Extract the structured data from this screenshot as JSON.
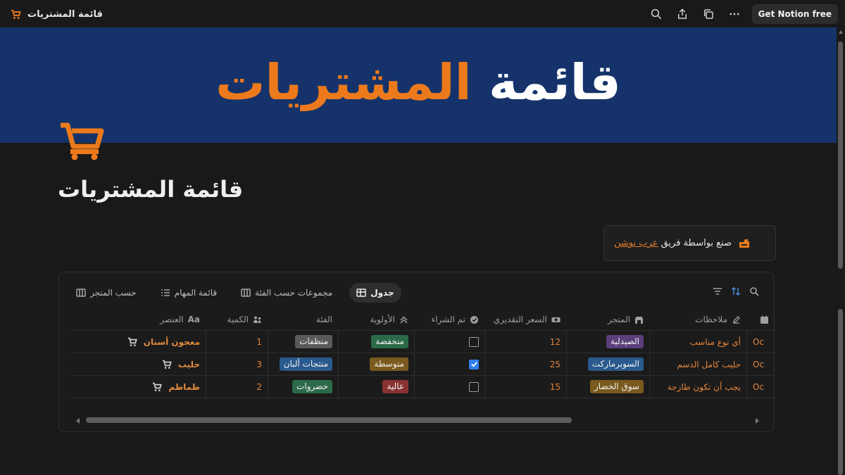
{
  "topbar": {
    "breadcrumb": "قائمة المشتريات",
    "get_free": "Get Notion free",
    "icons": [
      "search-icon",
      "share-icon",
      "duplicate-icon",
      "more-icon"
    ]
  },
  "banner": {
    "word_white": "قائمة",
    "word_orange": "المشتريات"
  },
  "page": {
    "title": "قائمة المشتريات"
  },
  "callout": {
    "text": "صنع بواسطة فريق",
    "link": "عرب نوشن"
  },
  "views": [
    {
      "label": "جدول",
      "active": true
    },
    {
      "label": "مجموعات حسب الفئة",
      "active": false
    },
    {
      "label": "قائمة المهام",
      "active": false
    },
    {
      "label": "حسب المتجر",
      "active": false
    }
  ],
  "columns": {
    "item": "العنصر",
    "qty": "الكمية",
    "category": "الفئة",
    "priority": "الأولوية",
    "bought": "تم الشراء",
    "price": "السعر التقديري",
    "store": "المتجر",
    "notes": "ملاحظات"
  },
  "rows": [
    {
      "item": "معجون أسنان",
      "qty": "1",
      "category": "منظفات",
      "priority": "منخفضة",
      "bought": false,
      "price": "12",
      "store": "الصيدلية",
      "notes": "أي نوع مناسب",
      "date": "Oc"
    },
    {
      "item": "حليب",
      "qty": "3",
      "category": "منتجات ألبان",
      "priority": "متوسطة",
      "bought": true,
      "price": "25",
      "store": "السوبرماركت",
      "notes": "حليب كامل الدسم",
      "date": "Oc"
    },
    {
      "item": "طماطم",
      "qty": "2",
      "category": "خضروات",
      "priority": "عالية",
      "bought": false,
      "price": "15",
      "store": "سوق الخضار",
      "notes": "يجب أن تكون طازجة",
      "date": "Oc"
    }
  ],
  "colors": {
    "accent": "#ec7a1c",
    "banner": "#15336a",
    "tag_gray": "#5a5a5a",
    "tag_blue": "#2a5a8e",
    "tag_green": "#2b6a48",
    "tag_brown": "#7a5a1e",
    "tag_red": "#8a3232",
    "tag_purple": "#5b3f7a"
  }
}
